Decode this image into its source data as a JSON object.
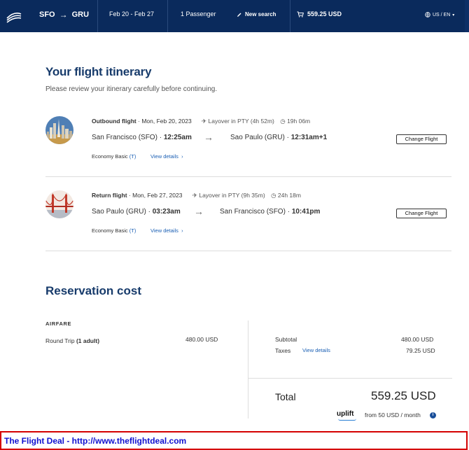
{
  "header": {
    "origin": "SFO",
    "destination": "GRU",
    "dates": "Feb 20 - Feb 27",
    "passengers": "1 Passenger",
    "new_search": "New search",
    "total_price": "559.25 USD",
    "locale": "US / EN",
    "colors": {
      "bar": "#0a2a5c"
    }
  },
  "itinerary": {
    "title": "Your flight itinerary",
    "subtitle": "Please review your itinerary carefully before continuing.",
    "flights": [
      {
        "label": "Outbound flight",
        "date": "Mon, Feb 20, 2023",
        "layover": "Layover in PTY (4h 52m)",
        "duration": "19h 06m",
        "from_city": "San Francisco (SFO)",
        "depart_time": "12:25am",
        "to_city": "Sao Paulo (GRU)",
        "arrive_time": "12:31am+1",
        "fare": "Economy Basic",
        "fare_code": "(T)",
        "view_details": "View details",
        "change": "Change Flight",
        "image": "san-francisco-skyline"
      },
      {
        "label": "Return flight",
        "date": "Mon, Feb 27, 2023",
        "layover": "Layover in PTY (9h 35m)",
        "duration": "24h 18m",
        "from_city": "Sao Paulo (GRU)",
        "depart_time": "03:23am",
        "to_city": "San Francisco (SFO)",
        "arrive_time": "10:41pm",
        "fare": "Economy Basic",
        "fare_code": "(T)",
        "view_details": "View details",
        "change": "Change Flight",
        "image": "golden-gate-bridge"
      }
    ]
  },
  "cost": {
    "title": "Reservation cost",
    "airfare_label": "AIRFARE",
    "round_trip_label": "Round Trip",
    "round_trip_qty": "(1 adult)",
    "round_trip_amount": "480.00 USD",
    "subtotal_label": "Subtotal",
    "subtotal_amount": "480.00 USD",
    "taxes_label": "Taxes",
    "taxes_link": "View details",
    "taxes_amount": "79.25 USD",
    "total_label": "Total",
    "total_amount": "559.25 USD",
    "uplift_brand": "uplift",
    "monthly_text": "from 50 USD  / month"
  },
  "banner": {
    "text": "The Flight Deal - http://www.theflightdeal.com",
    "border_color": "#d40000",
    "text_color": "#1010d0"
  }
}
